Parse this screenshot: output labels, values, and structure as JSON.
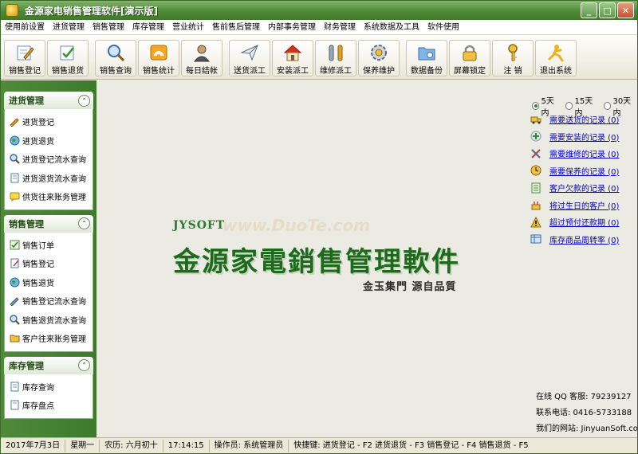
{
  "window": {
    "title": "金源家电销售管理软件[演示版]"
  },
  "menu": [
    "使用前设置",
    "进货管理",
    "销售管理",
    "库存管理",
    "营业统计",
    "售前售后管理",
    "内部事务管理",
    "财务管理",
    "系统数据及工具",
    "软件使用"
  ],
  "toolbar": [
    {
      "label": "销售登记",
      "icon": "register-pen-icon"
    },
    {
      "label": "销售退货",
      "icon": "return-check-icon"
    },
    {
      "label": "销售查询",
      "icon": "magnifier-icon"
    },
    {
      "label": "销售统计",
      "icon": "statistics-icon"
    },
    {
      "label": "每日结帐",
      "icon": "person-icon"
    },
    {
      "label": "送货派工",
      "icon": "paper-plane-icon"
    },
    {
      "label": "安装派工",
      "icon": "house-icon"
    },
    {
      "label": "维修派工",
      "icon": "wrench-icon"
    },
    {
      "label": "保养维护",
      "icon": "gear-icon"
    },
    {
      "label": "数据备份",
      "icon": "folder-icon"
    },
    {
      "label": "屏幕锁定",
      "icon": "lock-icon"
    },
    {
      "label": "注 销",
      "icon": "key-icon"
    },
    {
      "label": "退出系统",
      "icon": "exit-icon"
    }
  ],
  "sidebar": {
    "groups": [
      {
        "title": "进货管理",
        "items": [
          "进货登记",
          "进货退货",
          "进货登记流水查询",
          "进货退货流水查询",
          "供货往来账务管理"
        ]
      },
      {
        "title": "销售管理",
        "items": [
          "销售订单",
          "销售登记",
          "销售退货",
          "销售登记流水查询",
          "销售退货流水查询",
          "客户往来账务管理"
        ]
      },
      {
        "title": "库存管理",
        "items": [
          "库存查询",
          "库存盘点"
        ]
      }
    ]
  },
  "main": {
    "logo_brand": "JYSOFT",
    "logo_watermark": "www.DuoTe.com",
    "logo_title": "金源家電銷售管理軟件",
    "logo_slogan": "金玉集門  源自品質",
    "range_options": [
      {
        "label": "5天内",
        "selected": true
      },
      {
        "label": "15天内",
        "selected": false
      },
      {
        "label": "30天内",
        "selected": false
      }
    ],
    "reminders": [
      "需要送货的记录 (0)",
      "需要安装的记录 (0)",
      "需要维修的记录 (0)",
      "需要保养的记录 (0)",
      "客户欠款的记录 (0)",
      "将过生日的客户 (0)",
      "超过预付还款期 (0)",
      "库存商品周转率 (0)"
    ],
    "contact": {
      "qq": "在线 QQ 客服: 79239127",
      "phone": "联系电话: 0416-5733188",
      "site": "我们的网站: JinyuanSoft.com"
    }
  },
  "status": {
    "date": "2017年7月3日",
    "weekday": "星期一",
    "lunar": "农历: 六月初十",
    "time": "17:14:15",
    "operator": "操作员: 系统管理员",
    "shortcuts": "快捷键: 进货登记 - F2  进货退货 - F3  销售登记 - F4  销售退货 - F5"
  }
}
